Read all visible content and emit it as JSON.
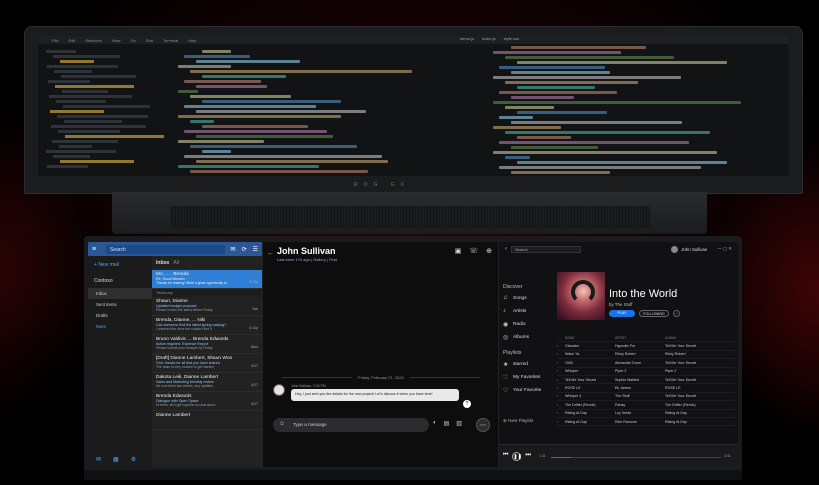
{
  "code_menu": [
    "File",
    "Edit",
    "Selection",
    "View",
    "Go",
    "Run",
    "Terminal",
    "Help"
  ],
  "code_tabs": [
    "demo.js",
    "index.js",
    "style.css"
  ],
  "brand": "ROG GX",
  "mail": {
    "search_placeholder": "Search",
    "new_mail": "New mail",
    "account": "Contoso",
    "folders": [
      "Inbox",
      "Sent items",
      "Drafts",
      "More"
    ],
    "list_title": "Inbox",
    "list_filter": "All",
    "messages": [
      {
        "from": "Mo, ... , Brenda",
        "subj": "Re: Good Mission",
        "prev": "Thanks for sharing! What a great opportunity to",
        "time": "6:13p",
        "selected": true
      },
      {
        "day": "Yesterday"
      },
      {
        "from": "Shaun, Dianne",
        "subj": "Updated budget proposal",
        "prev": "Please review the latest before Friday",
        "time": "Tue"
      },
      {
        "from": "Brenda, Dianne, ... Niki",
        "subj": "Can someone find the latest spring catalog?",
        "prev": "I checked the drive but couldn't find it",
        "time": "4:11p"
      },
      {
        "from": "Bruno Valdivic ... Brenda Edwards",
        "subj": "Action required: Expense Report",
        "prev": "Please submit your receipts by Friday",
        "time": "Mon"
      },
      {
        "from": "[Draft] Dianne Lambert, Shaun Woo",
        "subj": "Fwd: thanks for all that you have shared",
        "prev": "The team is very excited to get started",
        "time": "4/17"
      },
      {
        "from": "Dakota Leik, Dianne Lambert",
        "subj": "Sales and Marketing Monthly review",
        "prev": "It's now been two weeks, any updates",
        "time": "4/17"
      },
      {
        "from": "Brenda Edwards",
        "subj": "Dialogue with Open Space",
        "prev": "Hi there, let's get together to chat about",
        "time": "4/17"
      },
      {
        "from": "Dianne Lambert",
        "subj": "",
        "prev": "",
        "time": ""
      }
    ]
  },
  "skype": {
    "name": "John Sullivan",
    "status": "Last seen 17h ago | Gallery | Find",
    "date_divider": "Friday, February 21, 2020",
    "msg_meta": "John Sullivan, 2:30 PM",
    "message": "Hey, I just sent you the details for the new project! Let's discuss it when you have time!",
    "input_placeholder": "Type a message"
  },
  "music": {
    "search_placeholder": "Search",
    "user": "John Sullivan",
    "discover_header": "Discover",
    "nav": [
      {
        "icon": "♫",
        "label": "Songs"
      },
      {
        "icon": "♪",
        "label": "Artists"
      },
      {
        "icon": "◉",
        "label": "Radio"
      },
      {
        "icon": "◎",
        "label": "Albums"
      }
    ],
    "playlists_header": "Playlists",
    "playlists": [
      {
        "icon": "★",
        "label": "starred"
      },
      {
        "icon": "♡",
        "label": "My Favorites"
      },
      {
        "icon": "♡",
        "label": "Your Favorite"
      }
    ],
    "new_playlist": "New Playlist",
    "album_title": "Into the World",
    "album_by": "by The Stuff",
    "play_label": "PLAY",
    "follow_label": "FOLLOWING",
    "columns": [
      "SONG",
      "ARTIST",
      "ALBUM"
    ],
    "tracks": [
      [
        "Gianolex",
        "Hypnotic Fur",
        "Tell Me Your Secret"
      ],
      [
        "Wake Ya",
        "Ricky Robert",
        "Ricky Robert"
      ],
      [
        "1000",
        "Alexander Drum",
        "Tell Me Your Secret"
      ],
      [
        "Whisper",
        "Piper 2",
        "Piper 2"
      ],
      [
        "Tell Me Your Secret",
        "Sophie Marfied",
        "Tell Me Your Secret"
      ],
      [
        "ROSE LE",
        "Ek James",
        "ROSE LE"
      ],
      [
        "Whisper 3",
        "The Stuff",
        "Tell Me Your Secret"
      ],
      [
        "The Drifter (Remix)",
        "Parlay",
        "The Drifter (Remix)"
      ],
      [
        "Riding At Day",
        "Luy Vrede",
        "Riding At Day"
      ],
      [
        "Riding At Day",
        "Rich Ramone",
        "Riding At Day"
      ]
    ],
    "time_elapsed": "1:31",
    "time_total": "3:41",
    "progress": 0.12
  }
}
